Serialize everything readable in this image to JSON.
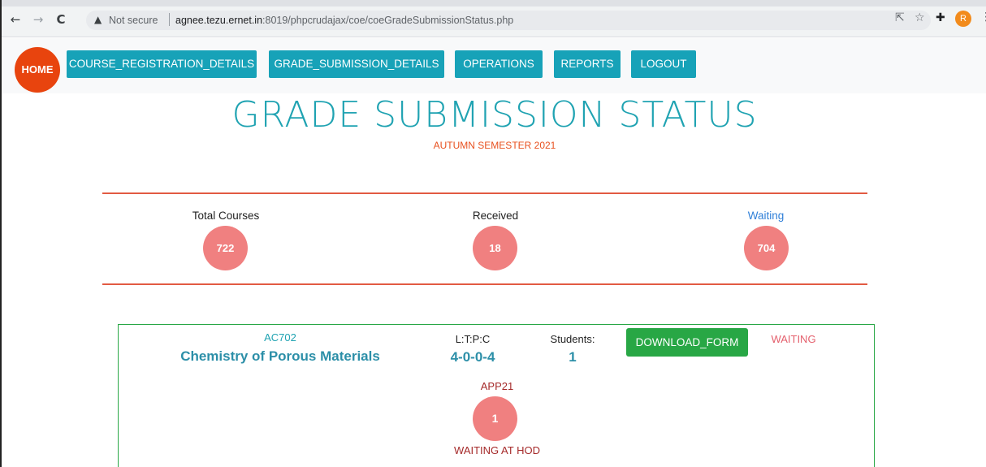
{
  "browser": {
    "back_icon": "←",
    "forward_icon": "→",
    "reload_icon": "C",
    "warning_icon": "▲",
    "security_text": "Not secure",
    "url_host": "agnee.tezu.ernet.in",
    "url_path": ":8019/phpcrudajax/coe/coeGradeSubmissionStatus.php",
    "share_icon": "⇱",
    "star_icon": "☆",
    "extensions_icon": "✚",
    "profile_initial": "R",
    "menu_icon": "⋮"
  },
  "nav": {
    "home": "HOME",
    "items": [
      "COURSE_REGISTRATION_DETAILS",
      "GRADE_SUBMISSION_DETAILS",
      "OPERATIONS",
      "REPORTS",
      "LOGOUT"
    ]
  },
  "header": {
    "title": "GRADE SUBMISSION STATUS",
    "semester": "AUTUMN SEMESTER 2021"
  },
  "stats": {
    "total_label": "Total Courses",
    "total_value": "722",
    "received_label": "Received",
    "received_value": "18",
    "waiting_label": "Waiting",
    "waiting_value": "704"
  },
  "course": {
    "code": "AC702",
    "name": "Chemistry of Porous Materials",
    "ltpc_label": "L:T:P:C",
    "ltpc_value": "4-0-0-4",
    "students_label": "Students:",
    "students_value": "1",
    "download_label": "DOWNLOAD_FORM",
    "status": "WAITING",
    "department": "APP21",
    "department_count": "1",
    "department_status": "WAITING AT HOD"
  },
  "colors": {
    "accent": "#17a2b8",
    "home": "#e8440e",
    "circle": "#f08080",
    "divider": "#e25a42",
    "success": "#28a745"
  }
}
